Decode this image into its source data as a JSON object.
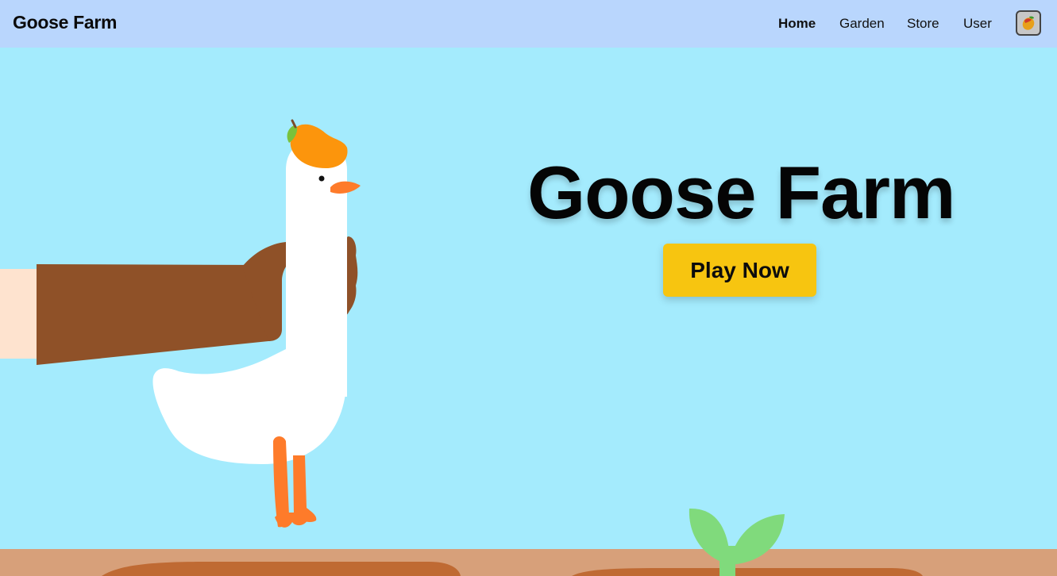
{
  "navbar": {
    "brand": "Goose Farm",
    "links": [
      {
        "label": "Home",
        "active": true
      },
      {
        "label": "Garden",
        "active": false
      },
      {
        "label": "Store",
        "active": false
      },
      {
        "label": "User",
        "active": false
      }
    ],
    "avatar_icon": "mango-icon"
  },
  "hero": {
    "title": "Goose Farm",
    "cta_label": "Play Now"
  },
  "colors": {
    "navbar_bg": "#b9d6fd",
    "sky": "#a4ebfd",
    "button": "#f7c510",
    "soil": "#d7a07a",
    "soil_dark": "#bf6a33",
    "glove": "#8f5128",
    "goose_beak": "#fe7b2a",
    "mango": "#fc950c",
    "sprout": "#80da7c"
  }
}
